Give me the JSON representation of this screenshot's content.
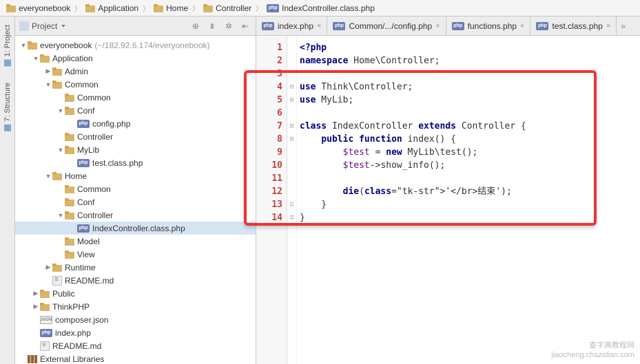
{
  "breadcrumbs": [
    {
      "icon": "folder",
      "label": "everyonebook"
    },
    {
      "icon": "folder",
      "label": "Application"
    },
    {
      "icon": "folder",
      "label": "Home"
    },
    {
      "icon": "folder",
      "label": "Controller"
    },
    {
      "icon": "php",
      "label": "IndexController.class.php"
    }
  ],
  "side_tabs": {
    "project": "1: Project",
    "structure": "7: Structure"
  },
  "project_panel": {
    "title": "Project"
  },
  "tree": [
    {
      "depth": 0,
      "arrow": "expanded",
      "icon": "folder",
      "label": "everyonebook",
      "extra": "(~/182.92.6.174/everyonebook)"
    },
    {
      "depth": 1,
      "arrow": "expanded",
      "icon": "folder",
      "label": "Application"
    },
    {
      "depth": 2,
      "arrow": "collapsed",
      "icon": "folder",
      "label": "Admin"
    },
    {
      "depth": 2,
      "arrow": "expanded",
      "icon": "folder",
      "label": "Common"
    },
    {
      "depth": 3,
      "arrow": "none",
      "icon": "folder",
      "label": "Common"
    },
    {
      "depth": 3,
      "arrow": "expanded",
      "icon": "folder",
      "label": "Conf"
    },
    {
      "depth": 4,
      "arrow": "none",
      "icon": "php",
      "label": "config.php"
    },
    {
      "depth": 3,
      "arrow": "none",
      "icon": "folder",
      "label": "Controller"
    },
    {
      "depth": 3,
      "arrow": "expanded",
      "icon": "folder",
      "label": "MyLib"
    },
    {
      "depth": 4,
      "arrow": "none",
      "icon": "php",
      "label": "test.class.php"
    },
    {
      "depth": 2,
      "arrow": "expanded",
      "icon": "folder",
      "label": "Home"
    },
    {
      "depth": 3,
      "arrow": "none",
      "icon": "folder",
      "label": "Common"
    },
    {
      "depth": 3,
      "arrow": "none",
      "icon": "folder",
      "label": "Conf"
    },
    {
      "depth": 3,
      "arrow": "expanded",
      "icon": "folder",
      "label": "Controller"
    },
    {
      "depth": 4,
      "arrow": "none",
      "icon": "php",
      "label": "IndexController.class.php",
      "selected": true
    },
    {
      "depth": 3,
      "arrow": "none",
      "icon": "folder",
      "label": "Model"
    },
    {
      "depth": 3,
      "arrow": "none",
      "icon": "folder",
      "label": "View"
    },
    {
      "depth": 2,
      "arrow": "collapsed",
      "icon": "folder",
      "label": "Runtime"
    },
    {
      "depth": 2,
      "arrow": "none",
      "icon": "md",
      "label": "README.md"
    },
    {
      "depth": 1,
      "arrow": "collapsed",
      "icon": "folder",
      "label": "Public"
    },
    {
      "depth": 1,
      "arrow": "collapsed",
      "icon": "folder",
      "label": "ThinkPHP"
    },
    {
      "depth": 1,
      "arrow": "none",
      "icon": "json",
      "label": "composer.json"
    },
    {
      "depth": 1,
      "arrow": "none",
      "icon": "php",
      "label": "index.php"
    },
    {
      "depth": 1,
      "arrow": "none",
      "icon": "md",
      "label": "README.md"
    },
    {
      "depth": 0,
      "arrow": "none",
      "icon": "lib",
      "label": "External Libraries"
    }
  ],
  "editor_tabs": [
    {
      "icon": "php",
      "label": "index.php"
    },
    {
      "icon": "php",
      "label": "Common/.../config.php"
    },
    {
      "icon": "php",
      "label": "functions.php"
    },
    {
      "icon": "php",
      "label": "test.class.php"
    }
  ],
  "tabs_overflow": "»",
  "code_lines": {
    "1": "<?php",
    "2": "namespace Home\\Controller;",
    "3": "",
    "4": "use Think\\Controller;",
    "5": "use MyLib;",
    "6": "",
    "7": "class IndexController extends Controller {",
    "8": "    public function index() {",
    "9": "        $test = new MyLib\\test();",
    "10": "        $test->show_info();",
    "11": "",
    "12": "        die('</br>结束');",
    "13": "    }",
    "14": "}"
  },
  "line_numbers": [
    "1",
    "2",
    "3",
    "4",
    "5",
    "6",
    "7",
    "8",
    "9",
    "10",
    "11",
    "12",
    "13",
    "14"
  ],
  "watermark": {
    "line1": "查字典教程网",
    "line2": "jiaocheng.chazidian.com"
  }
}
